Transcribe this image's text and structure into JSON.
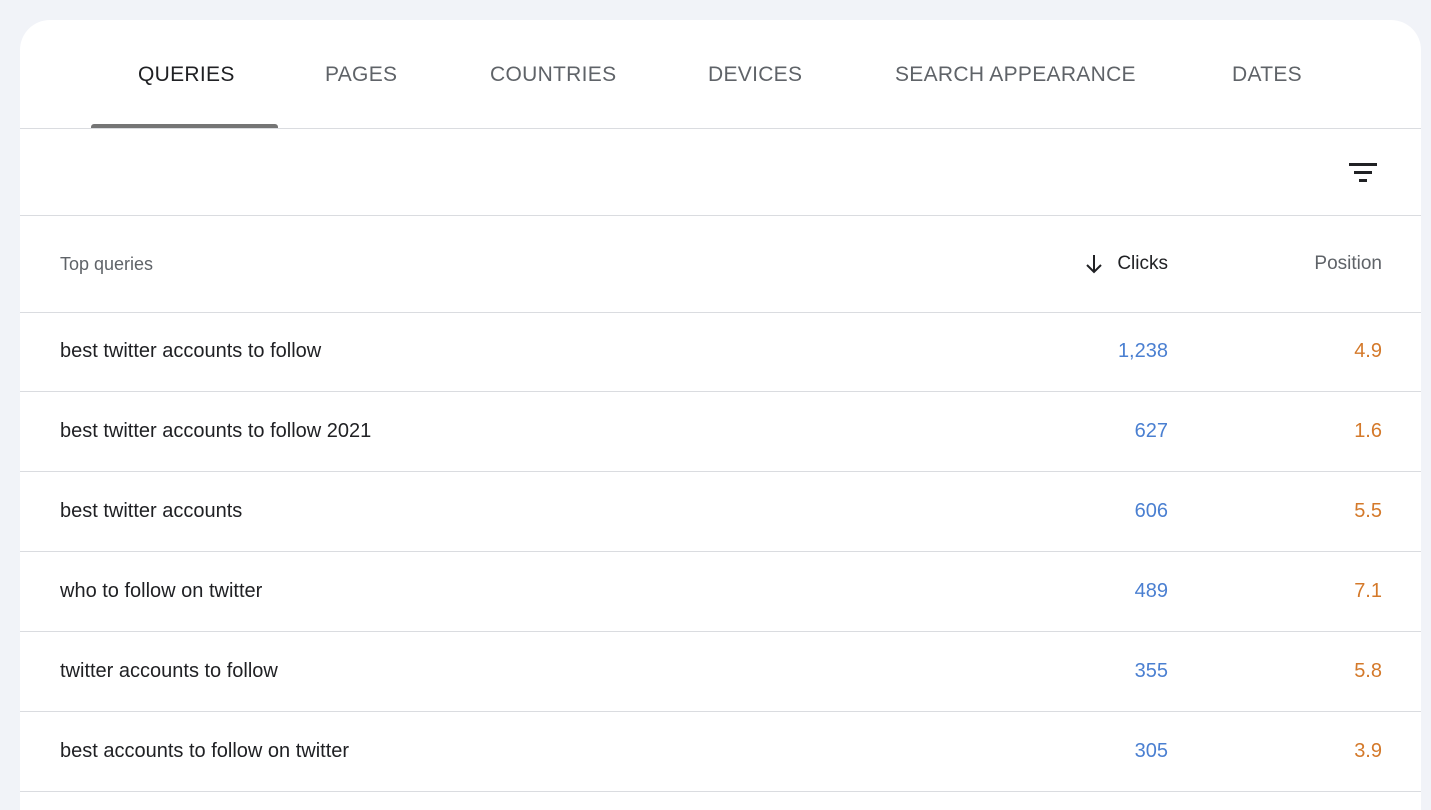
{
  "tabs": [
    {
      "label": "QUERIES",
      "active": true
    },
    {
      "label": "PAGES",
      "active": false
    },
    {
      "label": "COUNTRIES",
      "active": false
    },
    {
      "label": "DEVICES",
      "active": false
    },
    {
      "label": "SEARCH APPEARANCE",
      "active": false
    },
    {
      "label": "DATES",
      "active": false
    }
  ],
  "filter": {
    "icon": "filter-list-icon"
  },
  "table": {
    "headers": {
      "query": "Top queries",
      "clicks": "Clicks",
      "position": "Position",
      "sort_icon": "arrow-down-icon",
      "sorted_by": "clicks"
    },
    "rows": [
      {
        "query": "best twitter accounts to follow",
        "clicks": "1,238",
        "position": "4.9"
      },
      {
        "query": "best twitter accounts to follow 2021",
        "clicks": "627",
        "position": "1.6"
      },
      {
        "query": "best twitter accounts",
        "clicks": "606",
        "position": "5.5"
      },
      {
        "query": "who to follow on twitter",
        "clicks": "489",
        "position": "7.1"
      },
      {
        "query": "twitter accounts to follow",
        "clicks": "355",
        "position": "5.8"
      },
      {
        "query": "best accounts to follow on twitter",
        "clicks": "305",
        "position": "3.9"
      }
    ]
  },
  "colors": {
    "clicks": "#4a7fd1",
    "position": "#d4792a",
    "background": "#f1f3f8"
  }
}
